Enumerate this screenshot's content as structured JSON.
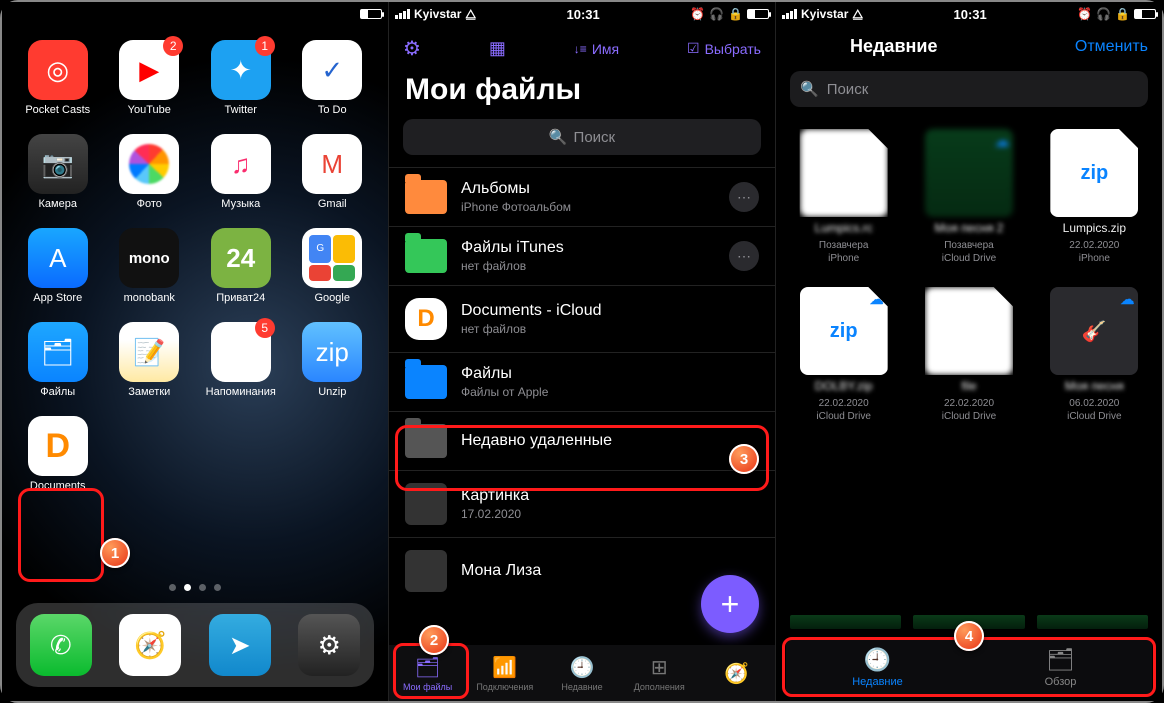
{
  "status": {
    "carrier": "Kyivstar",
    "time": "10:31"
  },
  "screen1": {
    "apps": [
      {
        "name": "Pocket Casts",
        "cls": "ic-pocket",
        "glyph": "◎"
      },
      {
        "name": "YouTube",
        "cls": "ic-yt",
        "glyph": "▶",
        "badge": "2"
      },
      {
        "name": "Twitter",
        "cls": "ic-tw",
        "glyph": "✦",
        "badge": "1"
      },
      {
        "name": "To Do",
        "cls": "ic-todo",
        "glyph": "✓"
      },
      {
        "name": "Камера",
        "cls": "ic-camera",
        "glyph": "📷"
      },
      {
        "name": "Фото",
        "cls": "ic-photos",
        "glyph": "photos"
      },
      {
        "name": "Музыка",
        "cls": "ic-music",
        "glyph": "♫"
      },
      {
        "name": "Gmail",
        "cls": "ic-gmail",
        "glyph": "M"
      },
      {
        "name": "App Store",
        "cls": "ic-appstore",
        "glyph": "A"
      },
      {
        "name": "monobank",
        "cls": "ic-mono",
        "glyph": "mono"
      },
      {
        "name": "Приват24",
        "cls": "ic-privat",
        "glyph": "24"
      },
      {
        "name": "Google",
        "cls": "ic-google",
        "glyph": "google"
      },
      {
        "name": "Файлы",
        "cls": "ic-files",
        "glyph": "🗂"
      },
      {
        "name": "Заметки",
        "cls": "ic-notes",
        "glyph": "📝"
      },
      {
        "name": "Напоминания",
        "cls": "ic-remind",
        "glyph": "●",
        "badge": "5"
      },
      {
        "name": "Unzip",
        "cls": "ic-unzip",
        "glyph": "zip"
      },
      {
        "name": "Documents",
        "cls": "ic-docs",
        "glyph": "D"
      }
    ],
    "dock": [
      {
        "cls": "ic-phone",
        "glyph": "✆"
      },
      {
        "cls": "ic-safari",
        "glyph": "🧭"
      },
      {
        "cls": "ic-telegram",
        "glyph": "➤"
      },
      {
        "cls": "ic-settings",
        "glyph": "⚙"
      }
    ]
  },
  "screen2": {
    "sort_label": "Имя",
    "select_label": "Выбрать",
    "title": "Мои файлы",
    "search_placeholder": "Поиск",
    "rows": [
      {
        "title": "Альбомы",
        "sub": "iPhone Фотоальбом",
        "color": "#ff8a3d",
        "more": true
      },
      {
        "title": "Файлы iTunes",
        "sub": "нет файлов",
        "color": "#34c759",
        "more": true
      },
      {
        "title": "Documents - iCloud",
        "sub": "нет файлов",
        "icon": "D"
      },
      {
        "title": "Файлы",
        "sub": "Файлы от Apple",
        "color": "#0a84ff"
      },
      {
        "title": "Недавно удаленные",
        "sub": "",
        "color": "#555"
      },
      {
        "title": "Картинка",
        "sub": "17.02.2020",
        "thumb": true
      },
      {
        "title": "Мона Лиза",
        "sub": "",
        "thumb": true
      }
    ],
    "tabs": [
      {
        "label": "Мои файлы",
        "glyph": "🗂",
        "active": true
      },
      {
        "label": "Подключения",
        "glyph": "📶"
      },
      {
        "label": "Недавние",
        "glyph": "🕘"
      },
      {
        "label": "Дополнения",
        "glyph": "⊞"
      },
      {
        "label": "",
        "glyph": "🧭"
      }
    ]
  },
  "screen3": {
    "title": "Недавние",
    "cancel": "Отменить",
    "search_placeholder": "Поиск",
    "items": [
      {
        "name": "Lumpics.rc",
        "meta1": "Позавчера",
        "meta2": "iPhone",
        "type": "doc",
        "blur": true
      },
      {
        "name": "Моя песня 2",
        "meta1": "Позавчера",
        "meta2": "iCloud Drive",
        "type": "img",
        "cloud": true,
        "blur": true
      },
      {
        "name": "Lumpics.zip",
        "meta1": "22.02.2020",
        "meta2": "iPhone",
        "type": "zip",
        "clear": true
      },
      {
        "name": "DOLBY.zip",
        "meta1": "22.02.2020",
        "meta2": "iCloud Drive",
        "type": "zip",
        "cloud": true,
        "blur": true
      },
      {
        "name": "file",
        "meta1": "22.02.2020",
        "meta2": "iCloud Drive",
        "type": "doc",
        "blur": true
      },
      {
        "name": "Моя песня",
        "meta1": "06.02.2020",
        "meta2": "iCloud Drive",
        "type": "gb",
        "cloud": true,
        "blur": true
      }
    ],
    "tabs": [
      {
        "label": "Недавние",
        "glyph": "🕘",
        "active": true
      },
      {
        "label": "Обзор",
        "glyph": "🗂"
      }
    ]
  },
  "steps": {
    "1": "1",
    "2": "2",
    "3": "3",
    "4": "4"
  }
}
